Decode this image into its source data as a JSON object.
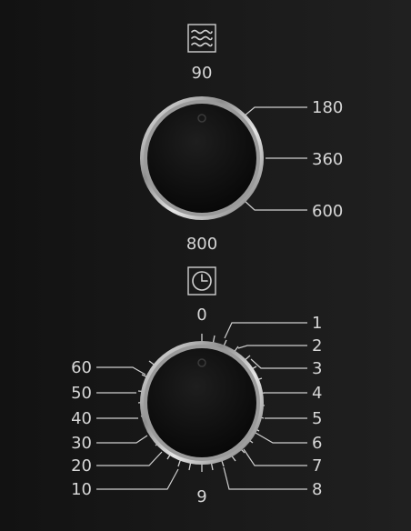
{
  "panel": {
    "power_dial": {
      "icon": "microwave-waves-icon",
      "labels": {
        "top": "90",
        "upper_right": "180",
        "right": "360",
        "lower_right": "600",
        "bottom": "800"
      }
    },
    "timer_dial": {
      "icon": "clock-icon",
      "top_label": "0",
      "bottom_label": "9",
      "right_labels": [
        "1",
        "2",
        "3",
        "4",
        "5",
        "6",
        "7",
        "8"
      ],
      "left_labels": [
        "60",
        "50",
        "40",
        "30",
        "20",
        "10"
      ]
    }
  },
  "colors": {
    "panel_background": "#161616",
    "label_text": "#d6d6d6",
    "knob_ring": "#c9c9c9",
    "knob_face": "#0b0b0b"
  }
}
